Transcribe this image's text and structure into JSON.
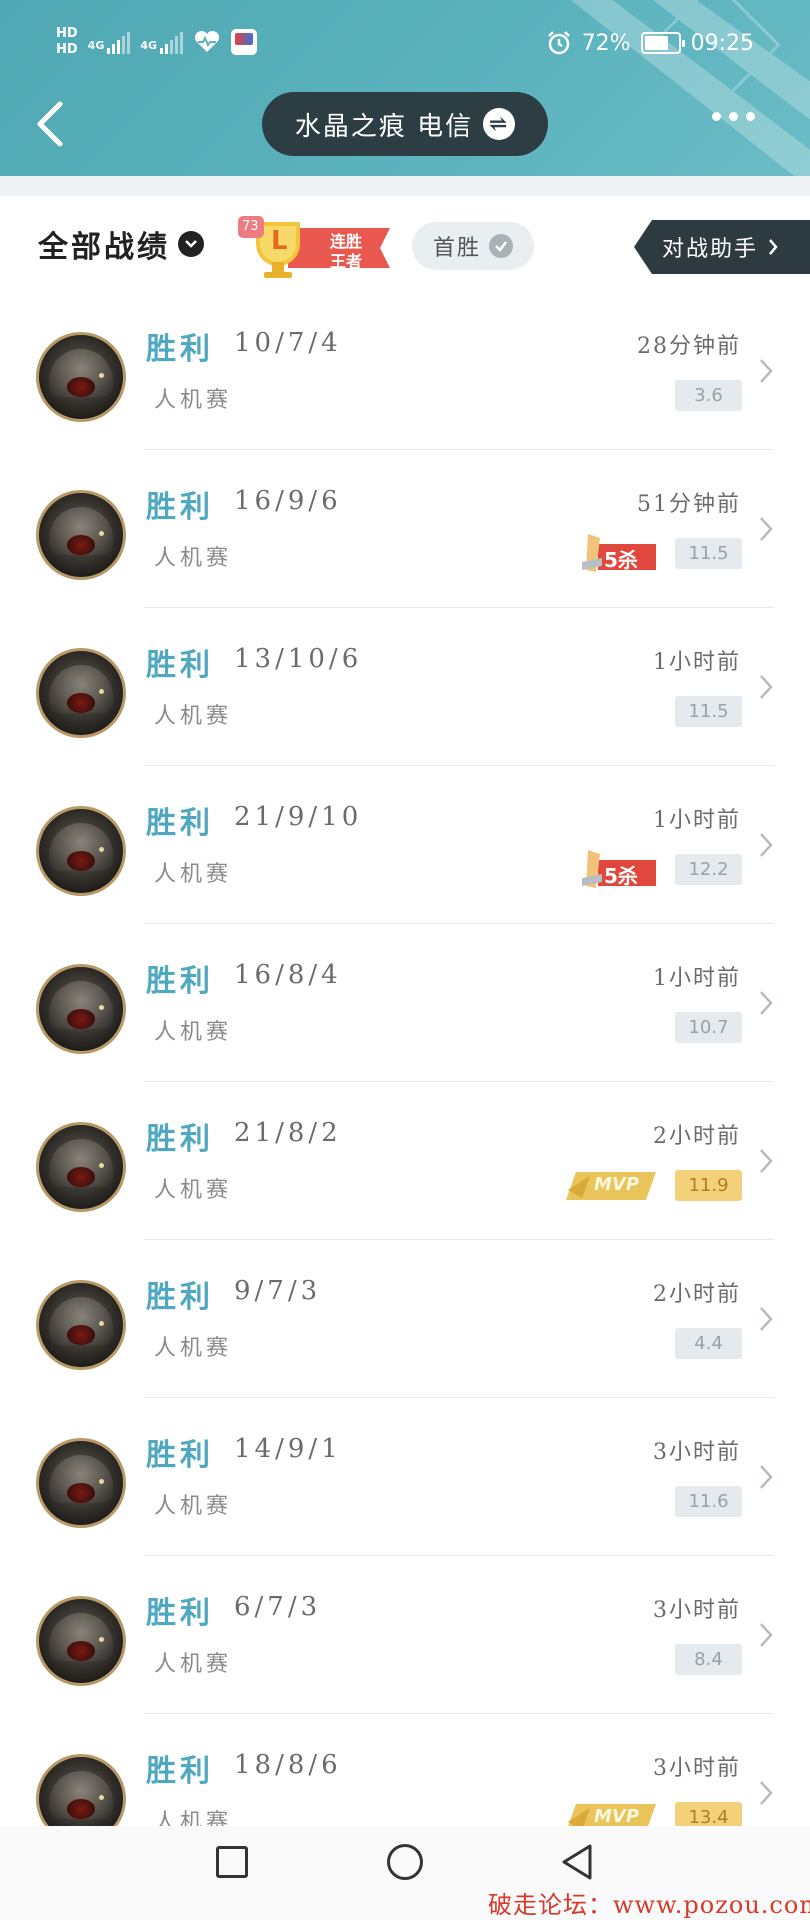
{
  "status_bar": {
    "hd1": "HD",
    "hd2": "HD",
    "net1": "4G",
    "net2": "4G",
    "battery": "72%",
    "battery_level": 0.72,
    "time": "09:25"
  },
  "header": {
    "title": "水晶之痕 电信",
    "swap_symbol": "⇌"
  },
  "filter": {
    "all_records": "全部战绩",
    "streak_badge_count": "73",
    "streak_badge_letter": "L",
    "streak_badge_text1": "连胜",
    "streak_badge_text2": "王者",
    "first_win": "首胜",
    "battle_assistant": "对战助手"
  },
  "matches": [
    {
      "result": "胜利",
      "kda": "10/7/4",
      "time": "28分钟前",
      "mode": "人机赛",
      "score": "3.6",
      "badge": ""
    },
    {
      "result": "胜利",
      "kda": "16/9/6",
      "time": "51分钟前",
      "mode": "人机赛",
      "score": "11.5",
      "badge": "5杀"
    },
    {
      "result": "胜利",
      "kda": "13/10/6",
      "time": "1小时前",
      "mode": "人机赛",
      "score": "11.5",
      "badge": ""
    },
    {
      "result": "胜利",
      "kda": "21/9/10",
      "time": "1小时前",
      "mode": "人机赛",
      "score": "12.2",
      "badge": "5杀"
    },
    {
      "result": "胜利",
      "kda": "16/8/4",
      "time": "1小时前",
      "mode": "人机赛",
      "score": "10.7",
      "badge": ""
    },
    {
      "result": "胜利",
      "kda": "21/8/2",
      "time": "2小时前",
      "mode": "人机赛",
      "score": "11.9",
      "badge": "MVP"
    },
    {
      "result": "胜利",
      "kda": "9/7/3",
      "time": "2小时前",
      "mode": "人机赛",
      "score": "4.4",
      "badge": ""
    },
    {
      "result": "胜利",
      "kda": "14/9/1",
      "time": "3小时前",
      "mode": "人机赛",
      "score": "11.6",
      "badge": ""
    },
    {
      "result": "胜利",
      "kda": "6/7/3",
      "time": "3小时前",
      "mode": "人机赛",
      "score": "8.4",
      "badge": ""
    },
    {
      "result": "胜利",
      "kda": "18/8/6",
      "time": "3小时前",
      "mode": "人机赛",
      "score": "13.4",
      "badge": "MVP"
    }
  ],
  "watermark": "破走论坛：www.pozou.com",
  "icons": [
    "back-arrow-icon",
    "swap-icon",
    "more-icon",
    "chevron-down-icon",
    "check-icon",
    "chevron-right-icon",
    "penta-kill-icon",
    "mvp-icon",
    "nav-recent-icon",
    "nav-home-icon",
    "nav-back-icon"
  ]
}
